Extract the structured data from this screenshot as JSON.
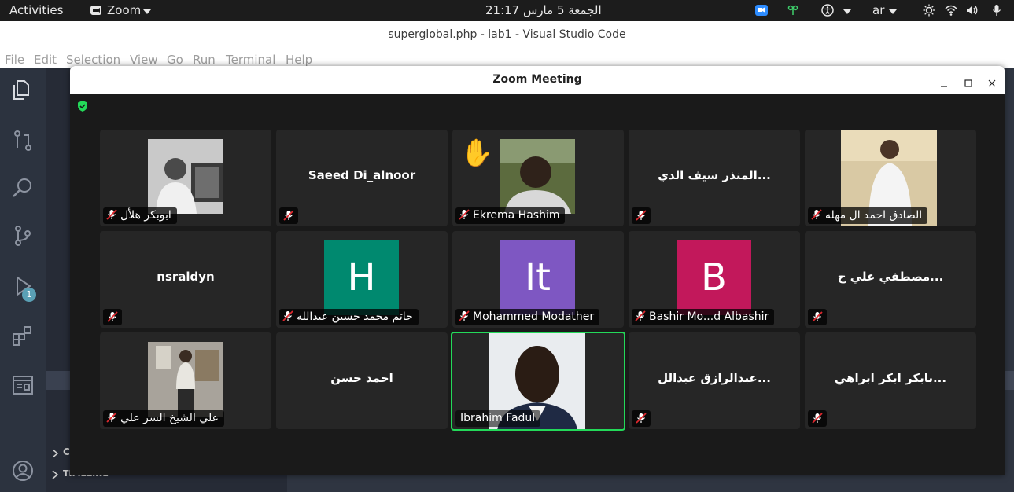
{
  "topbar": {
    "activities": "Activities",
    "app": "Zoom",
    "datetime": "الجمعة 5 مارس  21:17",
    "lang": "ar"
  },
  "vscode": {
    "title": "superglobal.php - lab1 - Visual Studio Code",
    "menu": [
      "File",
      "Edit",
      "Selection",
      "View",
      "Go",
      "Run",
      "Terminal",
      "Help"
    ],
    "debug_badge": "1",
    "outline_label": "C",
    "timeline_label": "TIMELINE"
  },
  "zoom": {
    "title": "Zoom Meeting",
    "colors": {
      "active_border": "#23d959",
      "h": "#00896f",
      "it": "#7e57c2",
      "b": "#c2185b"
    },
    "tiles": [
      {
        "display": "",
        "caption": "ابوبكر هلأل",
        "muted": true,
        "type": "photo"
      },
      {
        "display": "Saeed Di_alnoor",
        "caption": "",
        "muted": true,
        "type": "name"
      },
      {
        "display": "",
        "caption": "Ekrema Hashim",
        "muted": true,
        "type": "photo",
        "hand_raised": true
      },
      {
        "display": "المنذر سيف الدي...",
        "caption": "",
        "muted": true,
        "type": "name"
      },
      {
        "display": "",
        "caption": "الصادق احمد ال مهله",
        "muted": true,
        "type": "photo"
      },
      {
        "display": "nsraldyn",
        "caption": "",
        "muted": true,
        "type": "name"
      },
      {
        "display": "H",
        "caption": "حاتم محمد حسين عبدالله",
        "muted": true,
        "type": "avatar"
      },
      {
        "display": "It",
        "caption": "Mohammed Modather",
        "muted": true,
        "type": "avatar"
      },
      {
        "display": "B",
        "caption": "Bashir Mo...d Albashir",
        "muted": true,
        "type": "avatar"
      },
      {
        "display": "مصطفي علي ح...",
        "caption": "",
        "muted": true,
        "type": "name"
      },
      {
        "display": "",
        "caption": "علي الشيخ السر علي",
        "muted": true,
        "type": "photo"
      },
      {
        "display": "احمد حسن",
        "caption": "",
        "muted": false,
        "type": "name"
      },
      {
        "display": "",
        "caption": "Ibrahim Fadul",
        "muted": false,
        "type": "photo",
        "active": true
      },
      {
        "display": "عبدالرازق عبدالل...",
        "caption": "",
        "muted": true,
        "type": "name"
      },
      {
        "display": "بابكر ابكر ابراهي...",
        "caption": "",
        "muted": true,
        "type": "name"
      }
    ]
  }
}
